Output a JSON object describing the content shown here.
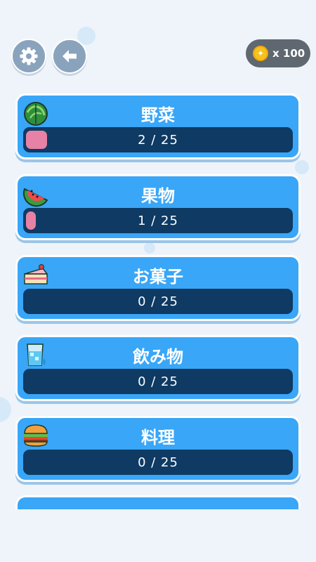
{
  "top_bar": {
    "settings_icon": "gear-icon",
    "back_icon": "arrow-left-icon",
    "coins": {
      "icon": "coin-icon",
      "text": "x 100"
    }
  },
  "categories": [
    {
      "title": "野菜",
      "icon": "cabbage-icon",
      "progress_text": "2 / 25",
      "progress": 0.08
    },
    {
      "title": "果物",
      "icon": "watermelon-icon",
      "progress_text": "1 / 25",
      "progress": 0.04
    },
    {
      "title": "お菓子",
      "icon": "cake-icon",
      "progress_text": "0 / 25",
      "progress": 0
    },
    {
      "title": "飲み物",
      "icon": "drink-icon",
      "progress_text": "0 / 25",
      "progress": 0
    },
    {
      "title": "料理",
      "icon": "burger-icon",
      "progress_text": "0 / 25",
      "progress": 0
    }
  ],
  "colors": {
    "card": "#39a6f7",
    "progress_bg": "#0e3a63",
    "progress_fill": "#e781a5",
    "button": "#8aa3bd",
    "coin_pill": "#5f6770"
  }
}
